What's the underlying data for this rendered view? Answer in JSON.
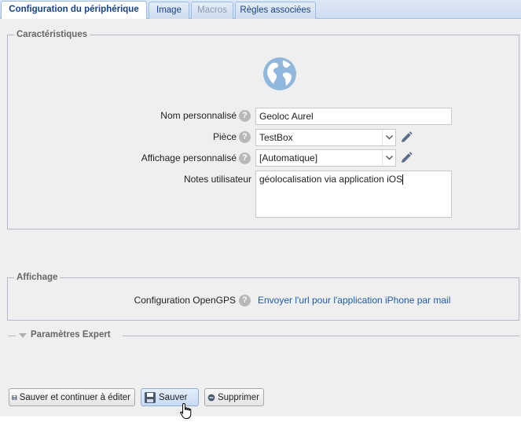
{
  "tabs": [
    {
      "label": "Configuration du périphérique",
      "active": true
    },
    {
      "label": "Image"
    },
    {
      "label": "Macros",
      "disabled": true
    },
    {
      "label": "Règles associées"
    }
  ],
  "caracteristiques": {
    "legend": "Caractéristiques",
    "icon": "globe-icon",
    "fields": {
      "nom": {
        "label": "Nom personnalisé",
        "value": "Geoloc Aurel"
      },
      "piece": {
        "label": "Pièce",
        "value": "TestBox"
      },
      "affichage": {
        "label": "Affichage personnalisé",
        "value": "[Automatique]"
      },
      "notes": {
        "label": "Notes utilisateur",
        "value": "géolocalisation via application iOS"
      }
    }
  },
  "affichage": {
    "legend": "Affichage",
    "opengps_label": "Configuration OpenGPS",
    "opengps_link": "Envoyer l'url pour l'application iPhone par mail"
  },
  "expert": {
    "legend": "Paramètres Expert",
    "collapsed": true
  },
  "buttons": {
    "save_continue": "Sauver et continuer à éditer",
    "save": "Sauver",
    "delete": "Supprimer"
  },
  "help_glyph": "?",
  "colors": {
    "link": "#1f5aa8",
    "tab_text": "#15428b",
    "globe": "#8fb8dc"
  }
}
